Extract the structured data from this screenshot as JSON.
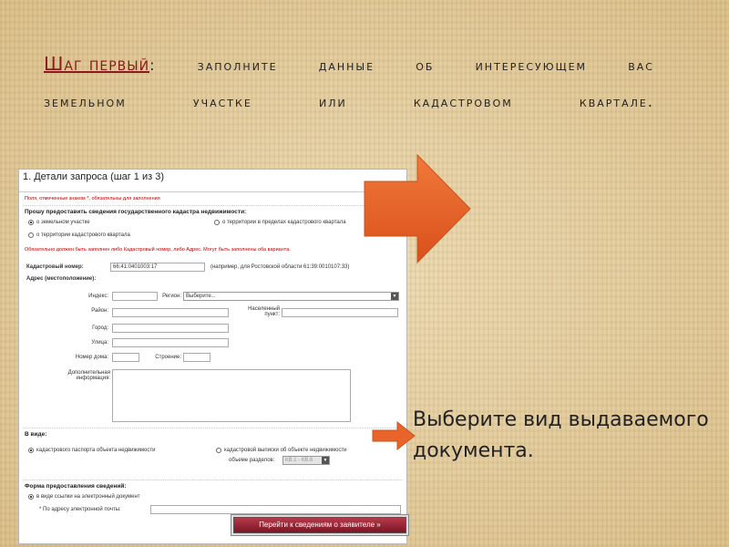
{
  "slide": {
    "title_step": "Шаг первый",
    "title_colon": ":",
    "title_line1_words": [
      "заполните",
      "данные",
      "об",
      "интересующем",
      "вас"
    ],
    "title_line2_words": [
      "земельном",
      "участке",
      "или",
      "кадастровом",
      "квартале."
    ],
    "callout": "Выберите вид выдаваемого документа."
  },
  "form": {
    "header": "1. Детали запроса (шаг 1 из 3)",
    "required_note": "Поля, отмеченные знаком *, обязательны для заполнения",
    "section_request_title": "Прошу предоставить сведения государственного кадастра недвижимости:",
    "radio_land": "о земельном участке",
    "radio_territory": "о территории в пределах кадастрового квартала",
    "radio_quarter": "о территории кадастрового квартала",
    "error_note": "Обязательно должен быть заполнен либо Кадастровый номер, либо Адрес. Могут быть заполнены оба варианта.",
    "cadastral_label": "Кадастровый номер:",
    "cadastral_value": "66:41:0401003:17",
    "cadastral_example": "(например, для Ростовской области 61:39:0010107:33)",
    "address_title": "Адрес (местоположение):",
    "index_label": "Индекс:",
    "region_label": "Регион:",
    "region_value": "Выберите...",
    "district_label": "Район:",
    "settlement_label": "Населенный пункт:",
    "city_label": "Город:",
    "street_label": "Улица:",
    "house_label": "Номер дома:",
    "building_label": "Строение:",
    "extra_label": "Дополнительная информация:",
    "view_title": "В виде:",
    "radio_passport": "кадастрового паспорта объекта недвижимости",
    "radio_extract": "кадастровой выписки об объекте недвижимости",
    "extract_volume": "объеме разделов:",
    "extract_select": "КВ.1 - КВ.6",
    "delivery_title": "Форма предоставления сведений:",
    "radio_email": "в виде ссылки на электронный документ",
    "email_label": "* По адресу электронной почты:",
    "submit": "Перейти к сведениям о заявителе »"
  },
  "colors": {
    "arrow": "#e8642a",
    "title_accent": "#8b1a1a",
    "button": "#8f1e2e"
  }
}
